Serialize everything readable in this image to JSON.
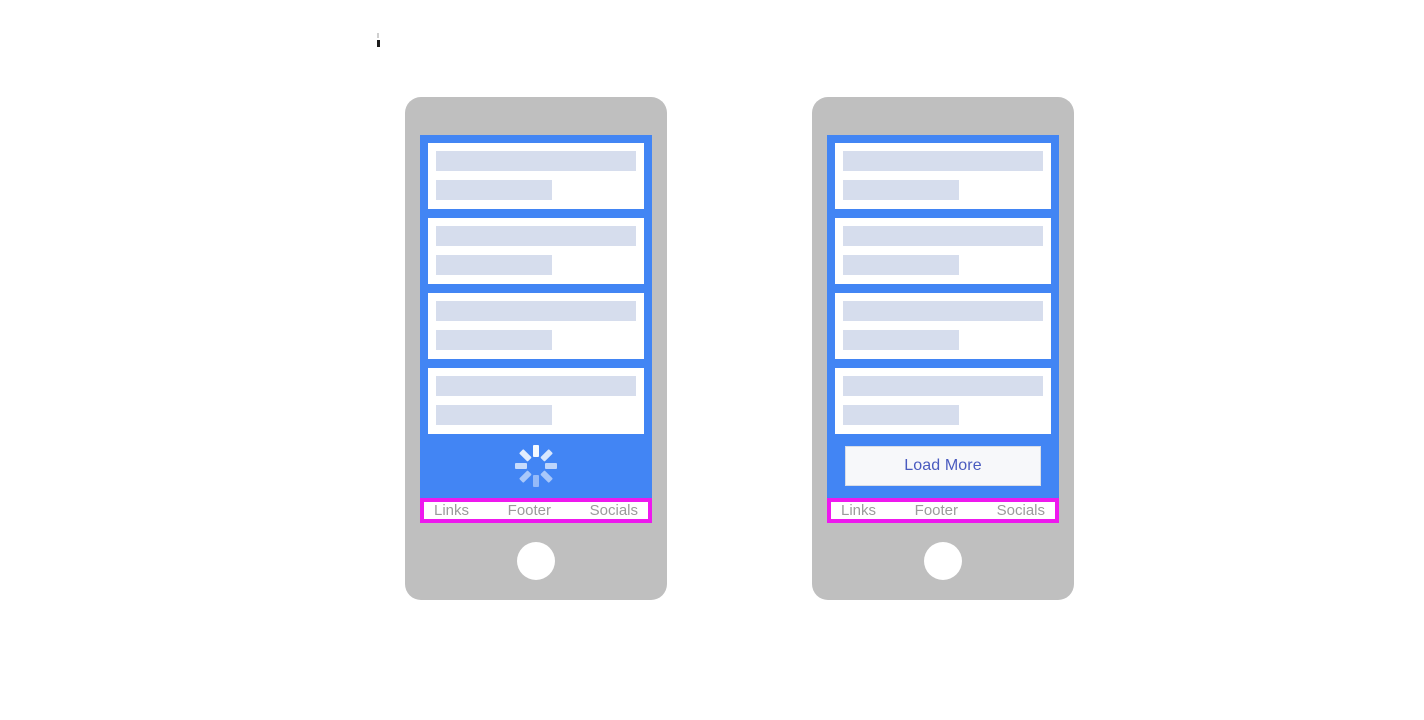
{
  "page": {
    "background_color": "#ffffff",
    "accent_blue": "#4285f4",
    "frame_gray": "#bfbfbf",
    "skeleton_gray": "#d6dded",
    "footer_border_magenta": "#ee18ee",
    "footer_text_color": "#9b9b9b",
    "button_text_color": "#4a5bbf"
  },
  "artifact": {
    "name": "text-caret-artifact"
  },
  "phones": [
    {
      "id": "phone-loading",
      "cards": [
        {
          "title_width": "100%",
          "subtitle_width": "58%"
        },
        {
          "title_width": "100%",
          "subtitle_width": "58%"
        },
        {
          "title_width": "100%",
          "subtitle_width": "58%"
        },
        {
          "title_width": "100%",
          "subtitle_width": "58%"
        }
      ],
      "action": {
        "type": "spinner",
        "icon": "loading-spinner-icon",
        "label": ""
      },
      "footer": {
        "links": [
          "Links",
          "Footer",
          "Socials"
        ]
      }
    },
    {
      "id": "phone-load-more",
      "cards": [
        {
          "title_width": "100%",
          "subtitle_width": "58%"
        },
        {
          "title_width": "100%",
          "subtitle_width": "58%"
        },
        {
          "title_width": "100%",
          "subtitle_width": "58%"
        },
        {
          "title_width": "100%",
          "subtitle_width": "58%"
        }
      ],
      "action": {
        "type": "button",
        "icon": "",
        "label": "Load More"
      },
      "footer": {
        "links": [
          "Links",
          "Footer",
          "Socials"
        ]
      }
    }
  ]
}
